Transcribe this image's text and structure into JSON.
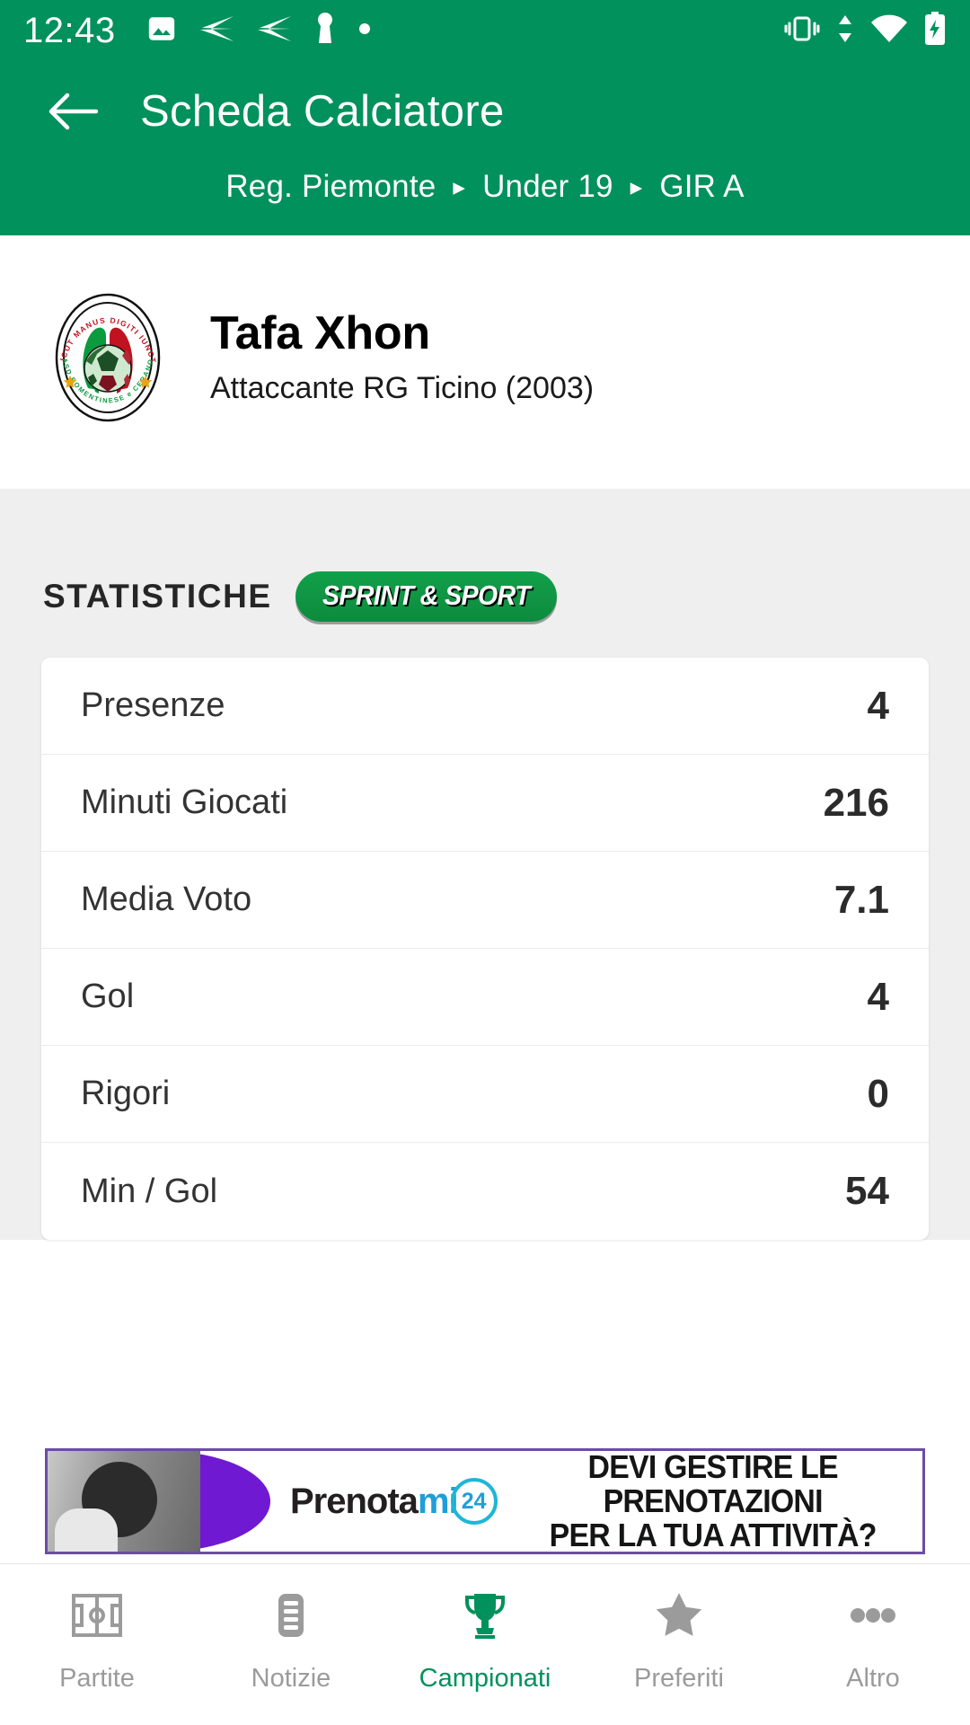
{
  "status_bar": {
    "clock": "12:43",
    "left_icons": [
      "image-icon",
      "send-icon",
      "send-icon",
      "key-icon",
      "dot-icon"
    ],
    "right_icons": [
      "vibrate-icon",
      "data-transfer-icon",
      "wifi-icon",
      "battery-charging-icon"
    ]
  },
  "app_bar": {
    "back_label": "back",
    "title": "Scheda Calciatore",
    "breadcrumb": {
      "separator": "▸",
      "items": [
        "Reg. Piemonte",
        "Under 19",
        "GIR A"
      ]
    },
    "accent_color": "#00915C"
  },
  "player": {
    "crest_alt": "ASD Romentinese e Cerano club crest",
    "crest_motto": "SICUT MANUS DIGITI IUNCTI",
    "name": "Tafa Xhon",
    "subtitle": "Attaccante RG Ticino (2003)"
  },
  "stats": {
    "title": "STATISTICHE",
    "sponsor_badge": "SPRINT & SPORT",
    "rows": [
      {
        "label": "Presenze",
        "value": "4"
      },
      {
        "label": "Minuti Giocati",
        "value": "216"
      },
      {
        "label": "Media Voto",
        "value": "7.1"
      },
      {
        "label": "Gol",
        "value": "4"
      },
      {
        "label": "Rigori",
        "value": "0"
      },
      {
        "label": "Min / Gol",
        "value": "54"
      }
    ]
  },
  "ad": {
    "brand": "Prenota",
    "brand_accent": "mi",
    "brand_badge": "24",
    "line1": "DEVI GESTIRE LE PRENOTAZIONI",
    "line2": "PER LA TUA ATTIVITÀ?",
    "border_color": "#6b4ca8"
  },
  "bottom_nav": {
    "active_index": 2,
    "active_color": "#00915C",
    "items": [
      {
        "label": "Partite",
        "icon": "pitch-icon"
      },
      {
        "label": "Notizie",
        "icon": "news-icon"
      },
      {
        "label": "Campionati",
        "icon": "trophy-icon"
      },
      {
        "label": "Preferiti",
        "icon": "star-icon"
      },
      {
        "label": "Altro",
        "icon": "more-icon"
      }
    ]
  }
}
